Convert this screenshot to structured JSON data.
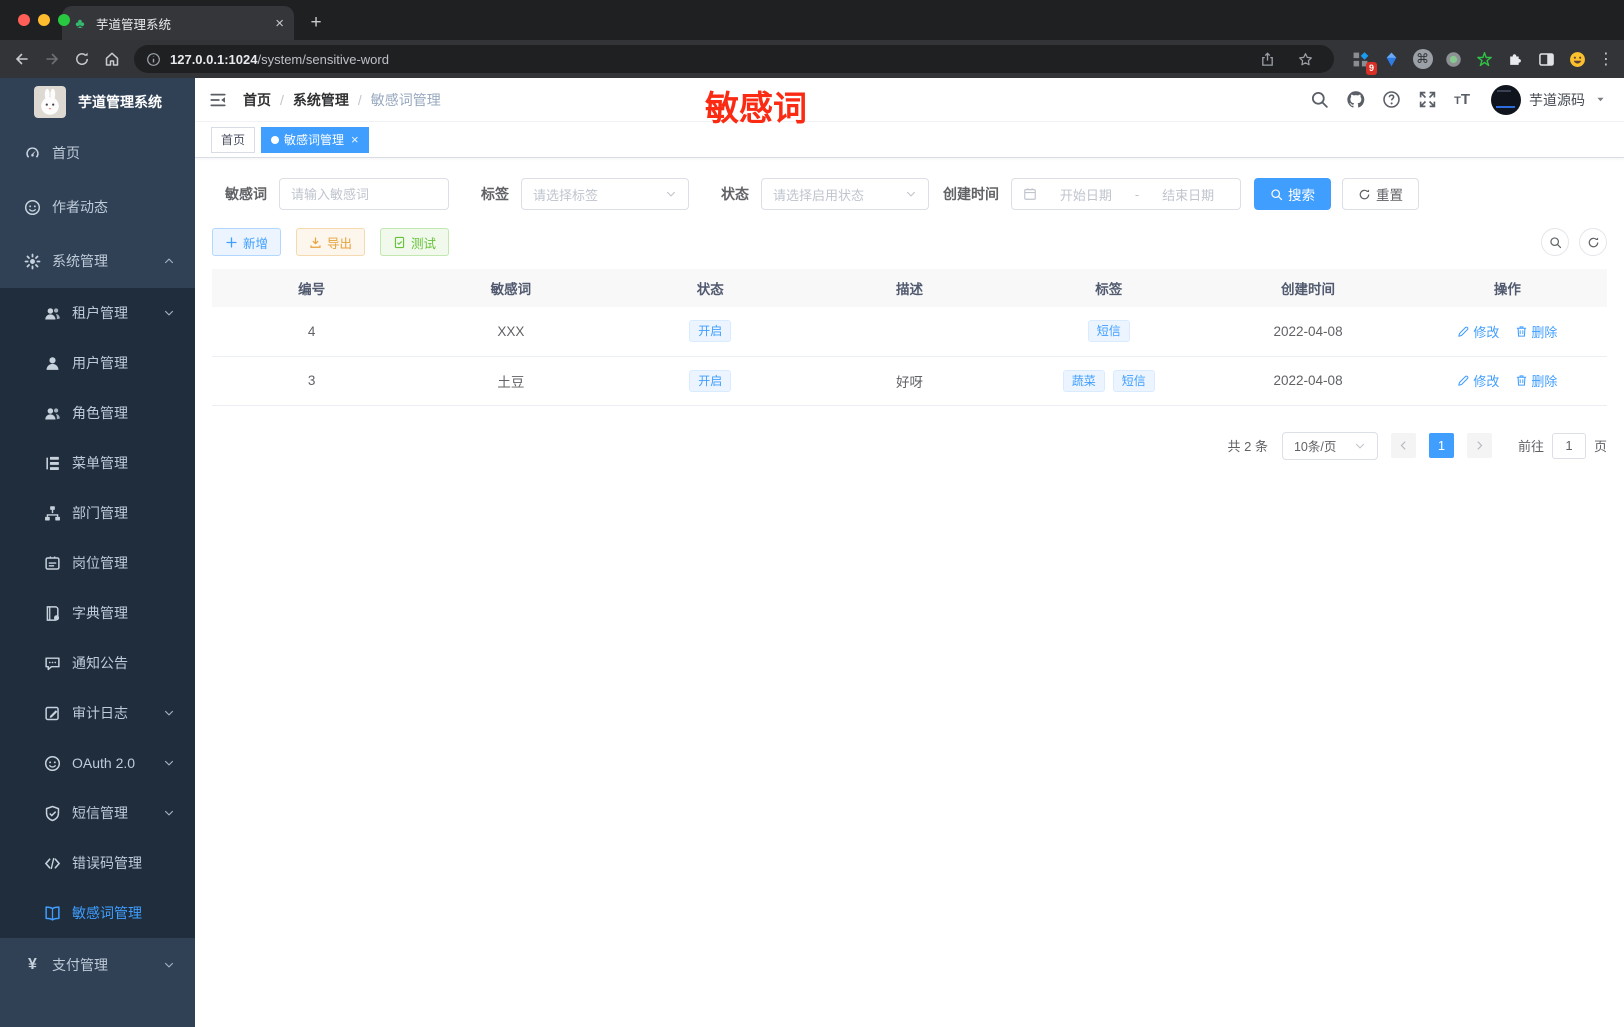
{
  "browser": {
    "tab_title": "芋道管理系统",
    "url_host": "127.0.0.1:1024",
    "url_path": "/system/sensitive-word",
    "extension_badge": "9"
  },
  "sidebar": {
    "logo_title": "芋道管理系统",
    "items": [
      {
        "key": "home",
        "label": "首页",
        "icon": "dashboard-icon",
        "level": 1
      },
      {
        "key": "author",
        "label": "作者动态",
        "icon": "author-icon",
        "level": 1
      },
      {
        "key": "system",
        "label": "系统管理",
        "icon": "gear-icon",
        "level": 1,
        "chevron": "up"
      },
      {
        "key": "tenant",
        "label": "租户管理",
        "icon": "tenants-icon",
        "level": 2,
        "chevron": "down"
      },
      {
        "key": "user",
        "label": "用户管理",
        "icon": "user-icon",
        "level": 2
      },
      {
        "key": "role",
        "label": "角色管理",
        "icon": "roles-icon",
        "level": 2
      },
      {
        "key": "menu",
        "label": "菜单管理",
        "icon": "menu-tree-icon",
        "level": 2
      },
      {
        "key": "dept",
        "label": "部门管理",
        "icon": "org-icon",
        "level": 2
      },
      {
        "key": "post",
        "label": "岗位管理",
        "icon": "post-icon",
        "level": 2
      },
      {
        "key": "dict",
        "label": "字典管理",
        "icon": "dict-icon",
        "level": 2
      },
      {
        "key": "notice",
        "label": "通知公告",
        "icon": "notice-icon",
        "level": 2
      },
      {
        "key": "log",
        "label": "审计日志",
        "icon": "log-icon",
        "level": 2,
        "chevron": "down"
      },
      {
        "key": "oauth",
        "label": "OAuth 2.0",
        "icon": "oauth-icon",
        "level": 2,
        "chevron": "down"
      },
      {
        "key": "sms",
        "label": "短信管理",
        "icon": "sms-icon",
        "level": 2,
        "chevron": "down"
      },
      {
        "key": "errcode",
        "label": "错误码管理",
        "icon": "code-icon",
        "level": 2
      },
      {
        "key": "sensitive",
        "label": "敏感词管理",
        "icon": "open-book-icon",
        "level": 2,
        "active": true
      },
      {
        "key": "pay",
        "label": "支付管理",
        "icon": "pay-icon",
        "level": 1,
        "chevron": "down"
      }
    ]
  },
  "header": {
    "breadcrumb": [
      "首页",
      "系统管理",
      "敏感词管理"
    ],
    "annotation": "敏感词",
    "annotation_color": "#fb2a13",
    "user_name": "芋道源码"
  },
  "tabs": [
    {
      "label": "首页",
      "active": false,
      "closable": false
    },
    {
      "label": "敏感词管理",
      "active": true,
      "closable": true
    }
  ],
  "filters": {
    "keyword_label": "敏感词",
    "keyword_placeholder": "请输入敏感词",
    "tag_label": "标签",
    "tag_placeholder": "请选择标签",
    "status_label": "状态",
    "status_placeholder": "请选择启用状态",
    "date_label": "创建时间",
    "date_start_placeholder": "开始日期",
    "date_separator": "-",
    "date_end_placeholder": "结束日期",
    "search_label": "搜索",
    "reset_label": "重置"
  },
  "toolbar": {
    "add_label": "新增",
    "export_label": "导出",
    "test_label": "测试"
  },
  "table": {
    "headers": [
      "编号",
      "敏感词",
      "状态",
      "描述",
      "标签",
      "创建时间",
      "操作"
    ],
    "rows": [
      {
        "id": "4",
        "word": "XXX",
        "status": "开启",
        "description": "",
        "tags": [
          "短信"
        ],
        "created": "2022-04-08"
      },
      {
        "id": "3",
        "word": "土豆",
        "status": "开启",
        "description": "好呀",
        "tags": [
          "蔬菜",
          "短信"
        ],
        "created": "2022-04-08"
      }
    ],
    "edit_label": "修改",
    "delete_label": "删除"
  },
  "pagination": {
    "total_label": "共 2 条",
    "page_size": "10条/页",
    "current_page": "1",
    "goto_label": "前往",
    "goto_value": "1",
    "page_unit": "页"
  },
  "colors": {
    "accent": "#409eff",
    "sidebar_bg": "#304156",
    "submenu_bg": "#1f2d3d",
    "warning": "#e6a23c",
    "success": "#67c23a"
  }
}
